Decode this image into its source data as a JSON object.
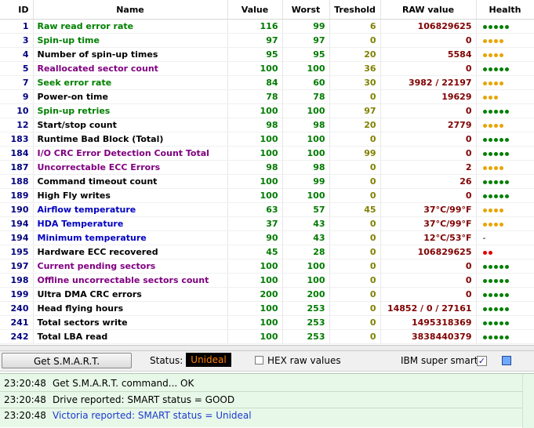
{
  "table": {
    "headers": {
      "id": "ID",
      "name": "Name",
      "value": "Value",
      "worst": "Worst",
      "threshold": "Treshold",
      "raw": "RAW value",
      "health": "Health"
    },
    "rows": [
      {
        "id": "1",
        "name": "Raw read error rate",
        "name_color": "green",
        "value": "116",
        "worst": "99",
        "threshold": "6",
        "raw": "106829625",
        "health": "ggggg"
      },
      {
        "id": "3",
        "name": "Spin-up time",
        "name_color": "green",
        "value": "97",
        "worst": "97",
        "threshold": "0",
        "raw": "0",
        "health": "yyyy"
      },
      {
        "id": "4",
        "name": "Number of spin-up times",
        "name_color": "black",
        "value": "95",
        "worst": "95",
        "threshold": "20",
        "raw": "5584",
        "health": "yyyy"
      },
      {
        "id": "5",
        "name": "Reallocated sector count",
        "name_color": "purple",
        "value": "100",
        "worst": "100",
        "threshold": "36",
        "raw": "0",
        "health": "ggggg"
      },
      {
        "id": "7",
        "name": "Seek error rate",
        "name_color": "green",
        "value": "84",
        "worst": "60",
        "threshold": "30",
        "raw": "3982 / 22197",
        "health": "yyyy"
      },
      {
        "id": "9",
        "name": "Power-on time",
        "name_color": "black",
        "value": "78",
        "worst": "78",
        "threshold": "0",
        "raw": "19629",
        "health": "yyy"
      },
      {
        "id": "10",
        "name": "Spin-up retries",
        "name_color": "green",
        "value": "100",
        "worst": "100",
        "threshold": "97",
        "raw": "0",
        "health": "ggggg"
      },
      {
        "id": "12",
        "name": "Start/stop count",
        "name_color": "black",
        "value": "98",
        "worst": "98",
        "threshold": "20",
        "raw": "2779",
        "health": "yyyy"
      },
      {
        "id": "183",
        "name": "Runtime Bad Block (Total)",
        "name_color": "black",
        "value": "100",
        "worst": "100",
        "threshold": "0",
        "raw": "0",
        "health": "ggggg"
      },
      {
        "id": "184",
        "name": "I/O CRC Error Detection Count Total",
        "name_color": "purple",
        "value": "100",
        "worst": "100",
        "threshold": "99",
        "raw": "0",
        "health": "ggggg"
      },
      {
        "id": "187",
        "name": "Uncorrectable ECC Errors",
        "name_color": "purple",
        "value": "98",
        "worst": "98",
        "threshold": "0",
        "raw": "2",
        "health": "yyyy"
      },
      {
        "id": "188",
        "name": "Command timeout count",
        "name_color": "black",
        "value": "100",
        "worst": "99",
        "threshold": "0",
        "raw": "26",
        "health": "ggggg"
      },
      {
        "id": "189",
        "name": "High Fly writes",
        "name_color": "black",
        "value": "100",
        "worst": "100",
        "threshold": "0",
        "raw": "0",
        "health": "ggggg"
      },
      {
        "id": "190",
        "name": "Airflow temperature",
        "name_color": "blue",
        "value": "63",
        "worst": "57",
        "threshold": "45",
        "raw": "37°C/99°F",
        "health": "yyyy"
      },
      {
        "id": "194",
        "name": "HDA Temperature",
        "name_color": "blue",
        "value": "37",
        "worst": "43",
        "threshold": "0",
        "raw": "37°C/99°F",
        "health": "yyyy"
      },
      {
        "id": "194",
        "name": "Minimum temperature",
        "name_color": "blue",
        "value": "90",
        "worst": "43",
        "threshold": "0",
        "raw": "12°C/53°F",
        "health": "-"
      },
      {
        "id": "195",
        "name": "Hardware ECC recovered",
        "name_color": "black",
        "value": "45",
        "worst": "28",
        "threshold": "0",
        "raw": "106829625",
        "health": "rr"
      },
      {
        "id": "197",
        "name": "Current pending sectors",
        "name_color": "purple",
        "value": "100",
        "worst": "100",
        "threshold": "0",
        "raw": "0",
        "health": "ggggg"
      },
      {
        "id": "198",
        "name": "Offline uncorrectable sectors count",
        "name_color": "purple",
        "value": "100",
        "worst": "100",
        "threshold": "0",
        "raw": "0",
        "health": "ggggg"
      },
      {
        "id": "199",
        "name": "Ultra DMA CRC errors",
        "name_color": "black",
        "value": "200",
        "worst": "200",
        "threshold": "0",
        "raw": "0",
        "health": "ggggg"
      },
      {
        "id": "240",
        "name": "Head flying hours",
        "name_color": "black",
        "value": "100",
        "worst": "253",
        "threshold": "0",
        "raw": "14852 / 0 / 27161",
        "health": "ggggg"
      },
      {
        "id": "241",
        "name": "Total sectors write",
        "name_color": "black",
        "value": "100",
        "worst": "253",
        "threshold": "0",
        "raw": "1495318369",
        "health": "ggggg"
      },
      {
        "id": "242",
        "name": "Total LBA read",
        "name_color": "black",
        "value": "100",
        "worst": "253",
        "threshold": "0",
        "raw": "3838440379",
        "health": "ggggg"
      }
    ]
  },
  "toolbar": {
    "get_smart_label": "Get S.M.A.R.T.",
    "status_label": "Status:",
    "status_value": "Unideal",
    "hex_raw_label": "HEX raw values",
    "hex_raw_checked": false,
    "ibm_label": "IBM super smart:",
    "ibm_checked": true,
    "ibm_check_glyph": "✓"
  },
  "log": [
    {
      "time": "23:20:48",
      "message": "Get S.M.A.R.T. command... OK",
      "color": "black"
    },
    {
      "time": "23:20:48",
      "message": "Drive reported: SMART status = GOOD",
      "color": "black"
    },
    {
      "time": "23:20:48",
      "message": "Victoria reported: SMART status = Unideal",
      "color": "blue"
    }
  ],
  "colors": {
    "status_bg": "#000000",
    "status_text": "#ff8000",
    "log_bg": "#e8f8e8",
    "health_good": "#008000",
    "health_warn": "#e8a400",
    "health_bad": "#e00000"
  }
}
